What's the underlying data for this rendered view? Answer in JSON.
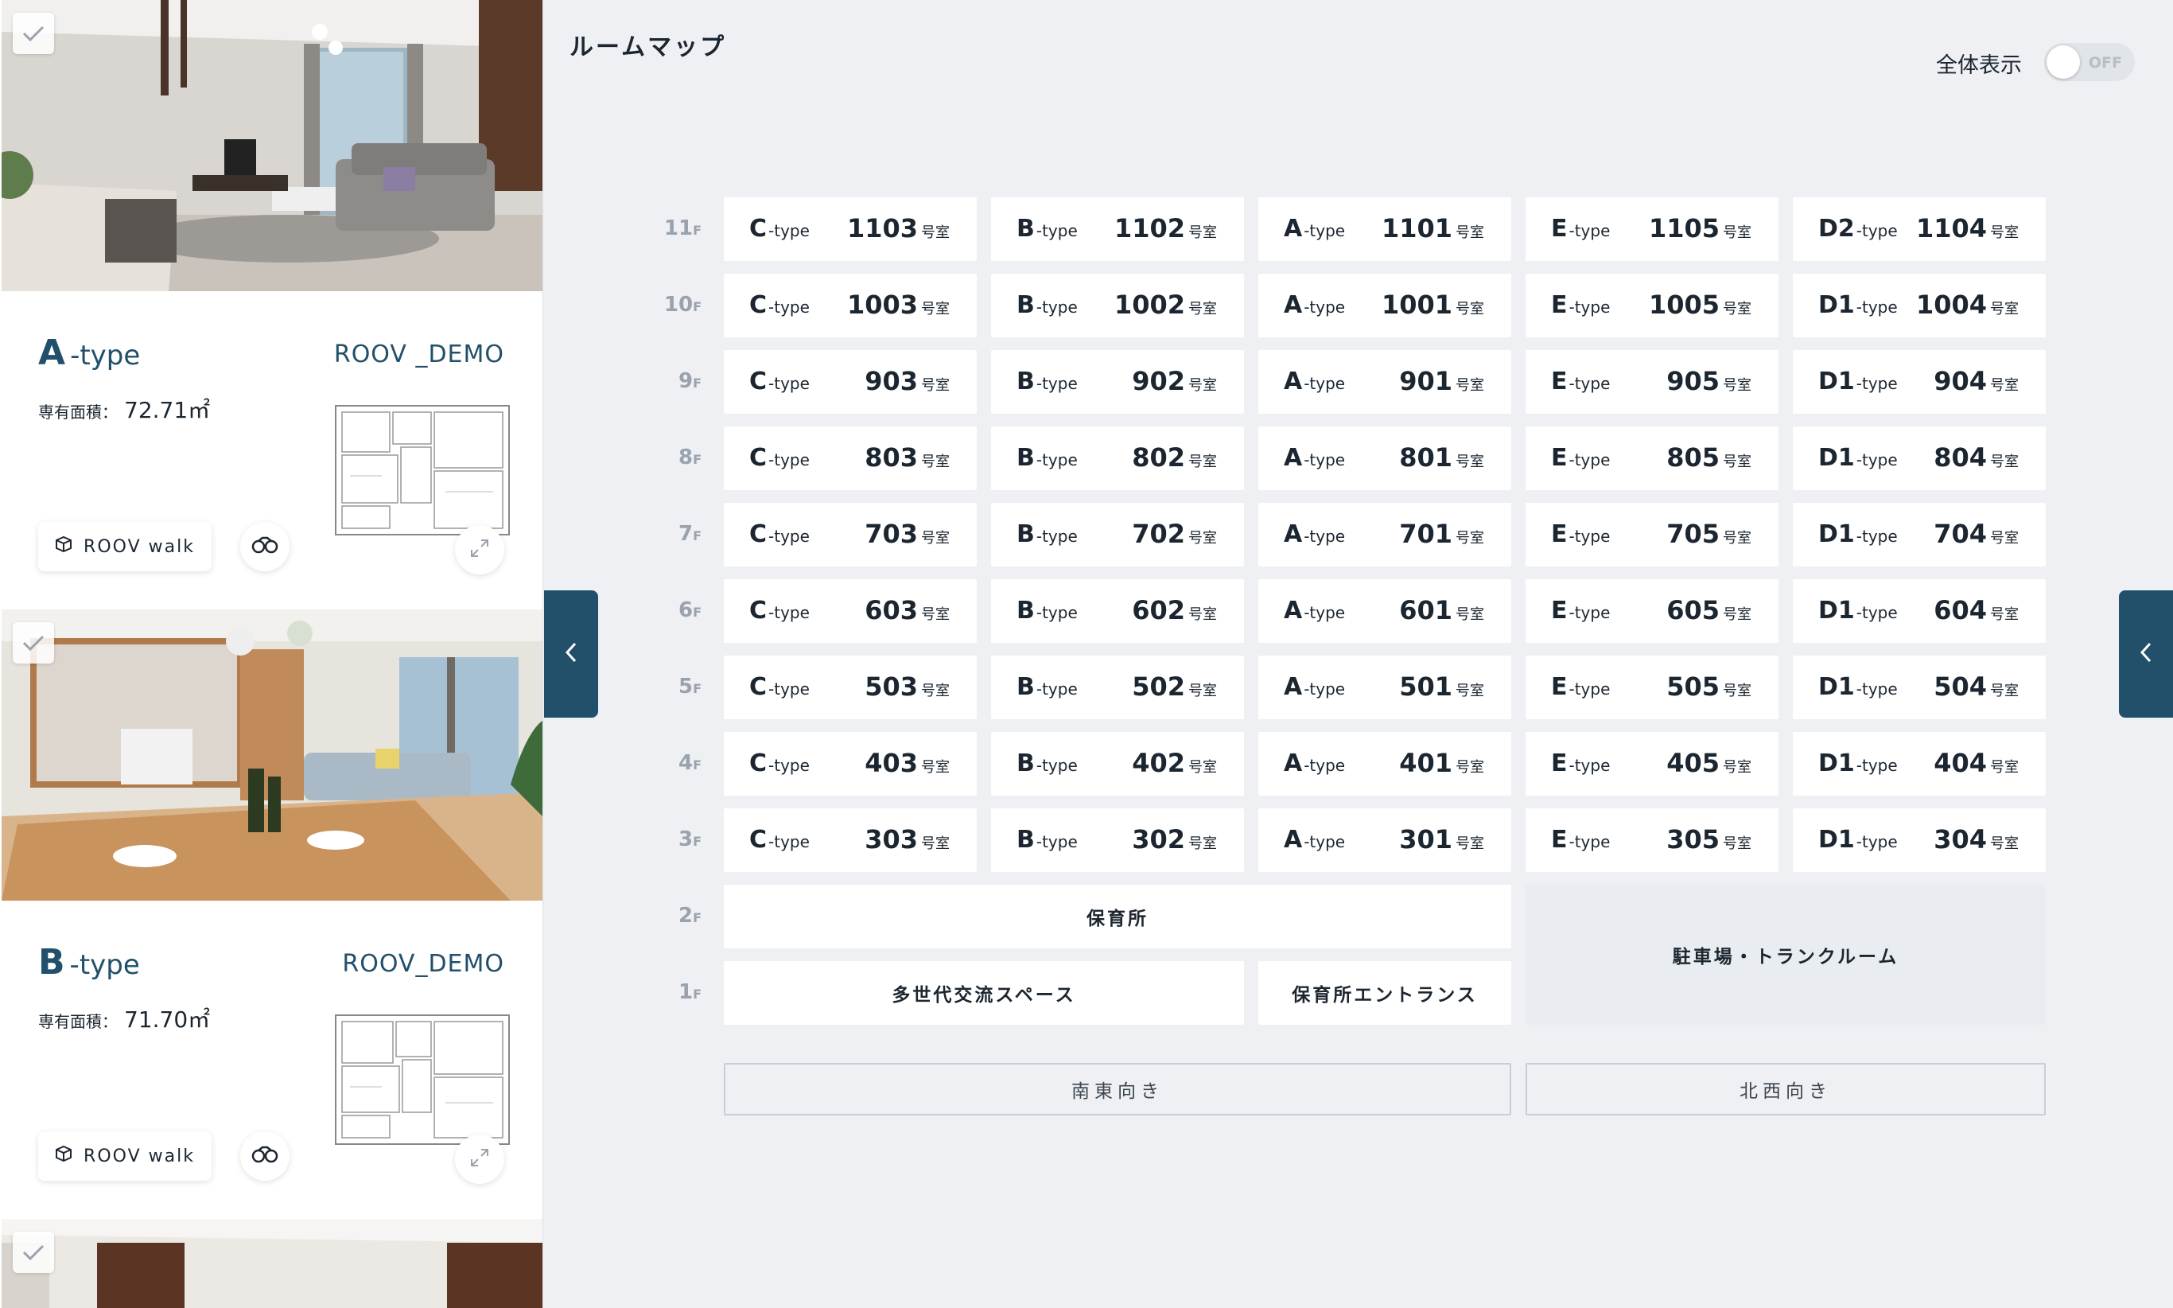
{
  "title": "ルームマップ",
  "toggle": {
    "label": "全体表示",
    "state": "OFF"
  },
  "cards": [
    {
      "type_letter": "A",
      "type_suffix": "-type",
      "project": "ROOV _DEMO",
      "area_label": "専有面積：",
      "area_value": "72.71㎡",
      "walk_label": "ROOV walk"
    },
    {
      "type_letter": "B",
      "type_suffix": "-type",
      "project": "ROOV_DEMO",
      "area_label": "専有面積：",
      "area_value": "71.70㎡",
      "walk_label": "ROOV walk"
    }
  ],
  "floors": [
    {
      "label": "11",
      "unit": "F",
      "rooms": [
        {
          "type": "C",
          "suffix": "-type",
          "num": "1103",
          "unit": "号室"
        },
        {
          "type": "B",
          "suffix": "-type",
          "num": "1102",
          "unit": "号室"
        },
        {
          "type": "A",
          "suffix": "-type",
          "num": "1101",
          "unit": "号室"
        },
        {
          "type": "E",
          "suffix": "-type",
          "num": "1105",
          "unit": "号室"
        },
        {
          "type": "D2",
          "suffix": "-type",
          "num": "1104",
          "unit": "号室"
        }
      ]
    },
    {
      "label": "10",
      "unit": "F",
      "rooms": [
        {
          "type": "C",
          "suffix": "-type",
          "num": "1003",
          "unit": "号室"
        },
        {
          "type": "B",
          "suffix": "-type",
          "num": "1002",
          "unit": "号室"
        },
        {
          "type": "A",
          "suffix": "-type",
          "num": "1001",
          "unit": "号室"
        },
        {
          "type": "E",
          "suffix": "-type",
          "num": "1005",
          "unit": "号室"
        },
        {
          "type": "D1",
          "suffix": "-type",
          "num": "1004",
          "unit": "号室"
        }
      ]
    },
    {
      "label": "9",
      "unit": "F",
      "rooms": [
        {
          "type": "C",
          "suffix": "-type",
          "num": "903",
          "unit": "号室"
        },
        {
          "type": "B",
          "suffix": "-type",
          "num": "902",
          "unit": "号室"
        },
        {
          "type": "A",
          "suffix": "-type",
          "num": "901",
          "unit": "号室"
        },
        {
          "type": "E",
          "suffix": "-type",
          "num": "905",
          "unit": "号室"
        },
        {
          "type": "D1",
          "suffix": "-type",
          "num": "904",
          "unit": "号室"
        }
      ]
    },
    {
      "label": "8",
      "unit": "F",
      "rooms": [
        {
          "type": "C",
          "suffix": "-type",
          "num": "803",
          "unit": "号室"
        },
        {
          "type": "B",
          "suffix": "-type",
          "num": "802",
          "unit": "号室"
        },
        {
          "type": "A",
          "suffix": "-type",
          "num": "801",
          "unit": "号室"
        },
        {
          "type": "E",
          "suffix": "-type",
          "num": "805",
          "unit": "号室"
        },
        {
          "type": "D1",
          "suffix": "-type",
          "num": "804",
          "unit": "号室"
        }
      ]
    },
    {
      "label": "7",
      "unit": "F",
      "rooms": [
        {
          "type": "C",
          "suffix": "-type",
          "num": "703",
          "unit": "号室"
        },
        {
          "type": "B",
          "suffix": "-type",
          "num": "702",
          "unit": "号室"
        },
        {
          "type": "A",
          "suffix": "-type",
          "num": "701",
          "unit": "号室"
        },
        {
          "type": "E",
          "suffix": "-type",
          "num": "705",
          "unit": "号室"
        },
        {
          "type": "D1",
          "suffix": "-type",
          "num": "704",
          "unit": "号室"
        }
      ]
    },
    {
      "label": "6",
      "unit": "F",
      "rooms": [
        {
          "type": "C",
          "suffix": "-type",
          "num": "603",
          "unit": "号室"
        },
        {
          "type": "B",
          "suffix": "-type",
          "num": "602",
          "unit": "号室"
        },
        {
          "type": "A",
          "suffix": "-type",
          "num": "601",
          "unit": "号室"
        },
        {
          "type": "E",
          "suffix": "-type",
          "num": "605",
          "unit": "号室"
        },
        {
          "type": "D1",
          "suffix": "-type",
          "num": "604",
          "unit": "号室"
        }
      ]
    },
    {
      "label": "5",
      "unit": "F",
      "rooms": [
        {
          "type": "C",
          "suffix": "-type",
          "num": "503",
          "unit": "号室"
        },
        {
          "type": "B",
          "suffix": "-type",
          "num": "502",
          "unit": "号室"
        },
        {
          "type": "A",
          "suffix": "-type",
          "num": "501",
          "unit": "号室"
        },
        {
          "type": "E",
          "suffix": "-type",
          "num": "505",
          "unit": "号室"
        },
        {
          "type": "D1",
          "suffix": "-type",
          "num": "504",
          "unit": "号室"
        }
      ]
    },
    {
      "label": "4",
      "unit": "F",
      "rooms": [
        {
          "type": "C",
          "suffix": "-type",
          "num": "403",
          "unit": "号室"
        },
        {
          "type": "B",
          "suffix": "-type",
          "num": "402",
          "unit": "号室"
        },
        {
          "type": "A",
          "suffix": "-type",
          "num": "401",
          "unit": "号室"
        },
        {
          "type": "E",
          "suffix": "-type",
          "num": "405",
          "unit": "号室"
        },
        {
          "type": "D1",
          "suffix": "-type",
          "num": "404",
          "unit": "号室"
        }
      ]
    },
    {
      "label": "3",
      "unit": "F",
      "rooms": [
        {
          "type": "C",
          "suffix": "-type",
          "num": "303",
          "unit": "号室"
        },
        {
          "type": "B",
          "suffix": "-type",
          "num": "302",
          "unit": "号室"
        },
        {
          "type": "A",
          "suffix": "-type",
          "num": "301",
          "unit": "号室"
        },
        {
          "type": "E",
          "suffix": "-type",
          "num": "305",
          "unit": "号室"
        },
        {
          "type": "D1",
          "suffix": "-type",
          "num": "304",
          "unit": "号室"
        }
      ]
    },
    {
      "label": "2",
      "unit": "F"
    },
    {
      "label": "1",
      "unit": "F"
    }
  ],
  "facilities": {
    "nursery": "保育所",
    "community": "多世代交流スペース",
    "nursery_entrance": "保育所エントランス",
    "parking": "駐車場・トランクルーム"
  },
  "directions": {
    "southeast": "南東向き",
    "northwest": "北西向き"
  },
  "icons": {
    "check": "check-icon",
    "cube": "cube-icon",
    "vr": "vr-goggles-icon",
    "expand": "expand-icon",
    "chevron": "chevron-left-icon"
  },
  "colors": {
    "accent": "#22506b",
    "background": "#eef0f4",
    "floor_label": "#9aa3ad"
  }
}
